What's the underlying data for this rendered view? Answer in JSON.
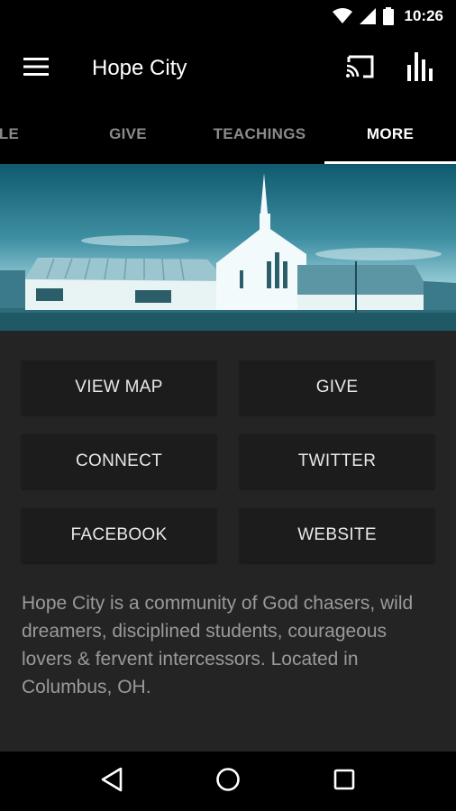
{
  "status_bar": {
    "time": "10:26",
    "icons": [
      "wifi-icon",
      "cell-signal-icon",
      "battery-icon"
    ]
  },
  "app_bar": {
    "title": "Hope City",
    "menu_icon": "hamburger-menu-icon",
    "actions": [
      "cast-icon",
      "bar-chart-icon"
    ]
  },
  "tabs": {
    "items": [
      {
        "label": "LE",
        "active": false
      },
      {
        "label": "GIVE",
        "active": false
      },
      {
        "label": "TEACHINGS",
        "active": false
      },
      {
        "label": "MORE",
        "active": true
      }
    ]
  },
  "buttons": [
    {
      "label": "VIEW MAP"
    },
    {
      "label": "GIVE"
    },
    {
      "label": "CONNECT"
    },
    {
      "label": "TWITTER"
    },
    {
      "label": "FACEBOOK"
    },
    {
      "label": "WEBSITE"
    }
  ],
  "description": "Hope City is a community of God chasers, wild dreamers, disciplined students, courageous lovers & fervent intercessors. Located in Columbus, OH.",
  "nav_bar": {
    "icons": [
      "back-icon",
      "home-icon",
      "recents-icon"
    ]
  },
  "colors": {
    "background": "#242424",
    "bar": "#000000",
    "button": "#1c1c1c",
    "active_tab": "#ffffff",
    "inactive_tab": "#8a8a8a"
  }
}
